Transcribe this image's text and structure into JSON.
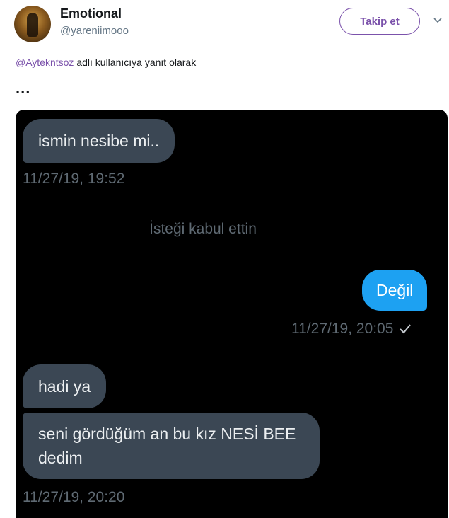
{
  "tweet": {
    "display_name": "Emotional",
    "handle": "@yareniimooo",
    "follow_label": "Takip et",
    "reply_mention": "@Aytekntsoz",
    "reply_suffix": " adlı kullanıcıya yanıt olarak",
    "text": "..."
  },
  "chat": {
    "messages": [
      {
        "text": "ismin nesibe mi..",
        "direction": "received"
      },
      {
        "timestamp": "11/27/19, 19:52"
      },
      {
        "system": "İsteği kabul ettin"
      },
      {
        "text": "Değil",
        "direction": "sent"
      },
      {
        "timestamp": "11/27/19, 20:05"
      },
      {
        "text": "hadi ya",
        "direction": "received"
      },
      {
        "text": "seni gördüğüm an bu kız NESİ BEE dedim",
        "direction": "received"
      },
      {
        "timestamp": "11/27/19, 20:20"
      }
    ]
  },
  "colors": {
    "accent": "#7b52ab",
    "sent_bubble": "#1da1f2",
    "received_bubble": "#3b4754",
    "chat_background": "#000000",
    "timestamp": "#5f6a73"
  },
  "icons": {
    "avatar": "profile-photo",
    "menu": "chevron-down-icon",
    "read_receipt": "checkmark-icon"
  }
}
